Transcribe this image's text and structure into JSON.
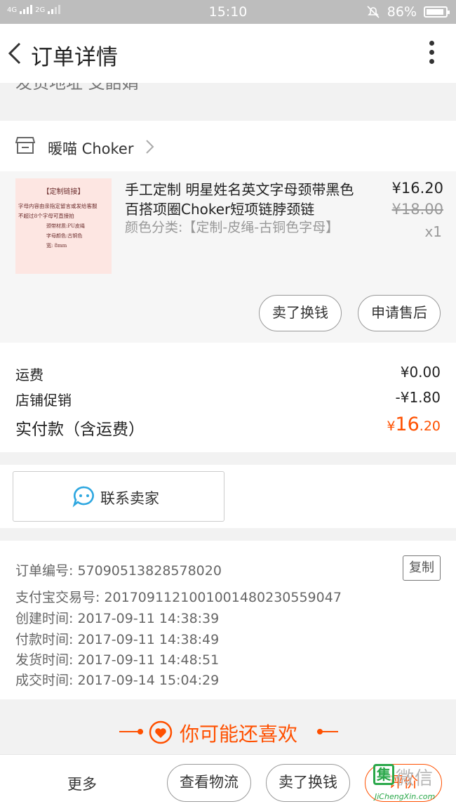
{
  "status_bar": {
    "network_left": "4G",
    "network_mid": "4G",
    "network_right": "2G",
    "time": "15:10",
    "battery": "86%"
  },
  "nav": {
    "title": "订单详情",
    "cut_text": "发货地址 支韶娟"
  },
  "shop": {
    "name": "暖喵 Choker"
  },
  "product": {
    "image_text": {
      "heading": "【定制链接】",
      "line1": "字母内容由亲指定留言或发给客服",
      "line2": "不超过8个字母可直接拍",
      "line3": "颈带材质:PU皮绳",
      "line4": "字母颜色:古铜色",
      "line5": "宽: 8mm"
    },
    "title": "手工定制 明星姓名英文字母颈带黑色百搭项圈Choker短项链脖颈链",
    "spec": "颜色分类:【定制-皮绳-古铜色字母】",
    "price": "¥16.20",
    "original_price": "¥18.00",
    "quantity": "x1",
    "sell_button": "卖了换钱",
    "after_sales_button": "申请售后"
  },
  "fees": {
    "shipping_label": "运费",
    "shipping_value": "¥0.00",
    "promo_label": "店铺促销",
    "promo_value": "-¥1.80",
    "total_label": "实付款（含运费）",
    "total_currency": "¥",
    "total_int": "16",
    "total_dec": ".20"
  },
  "contact": {
    "label": "联系卖家"
  },
  "order_info": {
    "order_no": "订单编号: 57090513828578020",
    "copy_button": "复制",
    "alipay_no": "支付宝交易号: 2017091121001001480230559047",
    "created": "创建时间: 2017-09-11 14:38:39",
    "paid": "付款时间: 2017-09-11 14:38:49",
    "shipped": "发货时间: 2017-09-11 14:48:51",
    "completed": "成交时间: 2017-09-14 15:04:29"
  },
  "recommend": {
    "title": "你可能还喜欢"
  },
  "bottom_bar": {
    "more": "更多",
    "logistics": "查看物流",
    "sell": "卖了换钱",
    "review": "评价"
  },
  "watermark": {
    "box": "集",
    "text": "微信",
    "sub": "JiChengXin.com"
  },
  "colors": {
    "accent": "#ff5000",
    "chat_blue": "#2ea7e0"
  }
}
